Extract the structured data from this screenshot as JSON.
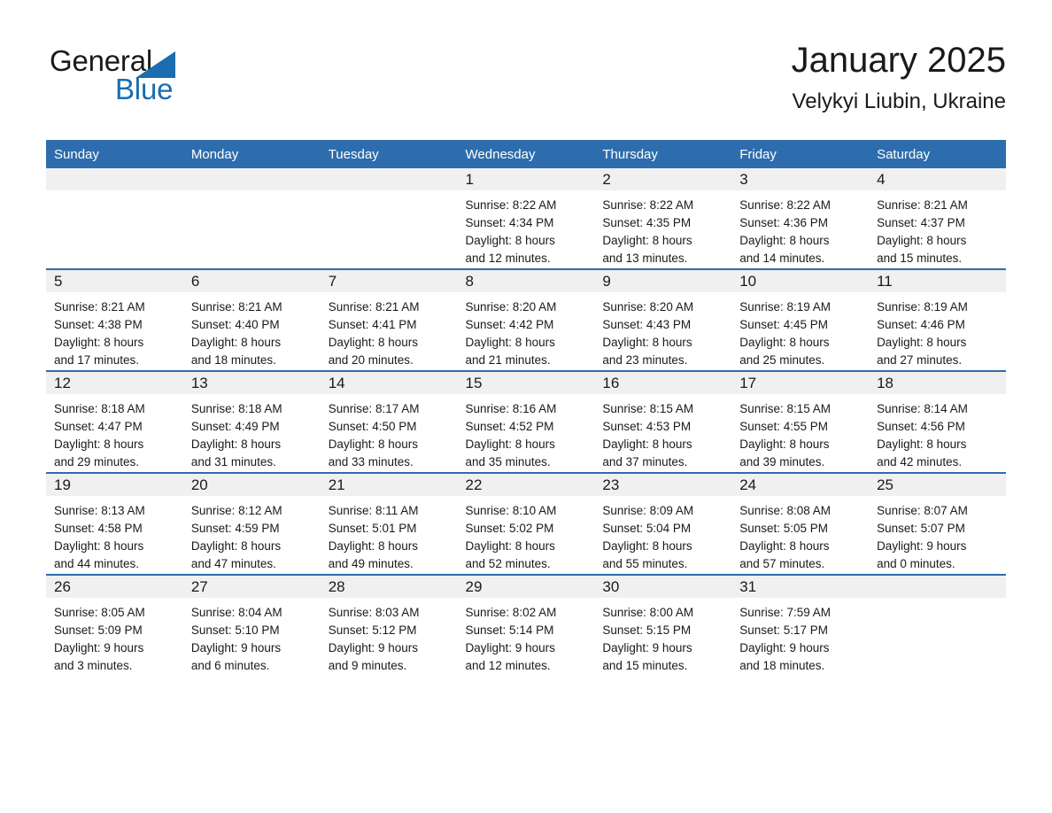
{
  "brand": {
    "name_part1": "General",
    "name_part2": "Blue",
    "triangle_color": "#1b6cb0"
  },
  "header": {
    "title": "January 2025",
    "subtitle": "Velykyi Liubin, Ukraine"
  },
  "theme": {
    "header_blue": "#2e6dad",
    "daynum_band": "#f0f0f0",
    "text": "#1a1a1a",
    "page_background": "#ffffff"
  },
  "weekday_headers": [
    "Sunday",
    "Monday",
    "Tuesday",
    "Wednesday",
    "Thursday",
    "Friday",
    "Saturday"
  ],
  "weeks": [
    {
      "days": [
        {
          "date": "",
          "empty": true,
          "sunrise": "",
          "sunset": "",
          "daylight_line1": "",
          "daylight_line2": ""
        },
        {
          "date": "",
          "empty": true,
          "sunrise": "",
          "sunset": "",
          "daylight_line1": "",
          "daylight_line2": ""
        },
        {
          "date": "",
          "empty": true,
          "sunrise": "",
          "sunset": "",
          "daylight_line1": "",
          "daylight_line2": ""
        },
        {
          "date": "1",
          "empty": false,
          "sunrise": "Sunrise: 8:22 AM",
          "sunset": "Sunset: 4:34 PM",
          "daylight_line1": "Daylight: 8 hours",
          "daylight_line2": "and 12 minutes."
        },
        {
          "date": "2",
          "empty": false,
          "sunrise": "Sunrise: 8:22 AM",
          "sunset": "Sunset: 4:35 PM",
          "daylight_line1": "Daylight: 8 hours",
          "daylight_line2": "and 13 minutes."
        },
        {
          "date": "3",
          "empty": false,
          "sunrise": "Sunrise: 8:22 AM",
          "sunset": "Sunset: 4:36 PM",
          "daylight_line1": "Daylight: 8 hours",
          "daylight_line2": "and 14 minutes."
        },
        {
          "date": "4",
          "empty": false,
          "sunrise": "Sunrise: 8:21 AM",
          "sunset": "Sunset: 4:37 PM",
          "daylight_line1": "Daylight: 8 hours",
          "daylight_line2": "and 15 minutes."
        }
      ]
    },
    {
      "days": [
        {
          "date": "5",
          "empty": false,
          "sunrise": "Sunrise: 8:21 AM",
          "sunset": "Sunset: 4:38 PM",
          "daylight_line1": "Daylight: 8 hours",
          "daylight_line2": "and 17 minutes."
        },
        {
          "date": "6",
          "empty": false,
          "sunrise": "Sunrise: 8:21 AM",
          "sunset": "Sunset: 4:40 PM",
          "daylight_line1": "Daylight: 8 hours",
          "daylight_line2": "and 18 minutes."
        },
        {
          "date": "7",
          "empty": false,
          "sunrise": "Sunrise: 8:21 AM",
          "sunset": "Sunset: 4:41 PM",
          "daylight_line1": "Daylight: 8 hours",
          "daylight_line2": "and 20 minutes."
        },
        {
          "date": "8",
          "empty": false,
          "sunrise": "Sunrise: 8:20 AM",
          "sunset": "Sunset: 4:42 PM",
          "daylight_line1": "Daylight: 8 hours",
          "daylight_line2": "and 21 minutes."
        },
        {
          "date": "9",
          "empty": false,
          "sunrise": "Sunrise: 8:20 AM",
          "sunset": "Sunset: 4:43 PM",
          "daylight_line1": "Daylight: 8 hours",
          "daylight_line2": "and 23 minutes."
        },
        {
          "date": "10",
          "empty": false,
          "sunrise": "Sunrise: 8:19 AM",
          "sunset": "Sunset: 4:45 PM",
          "daylight_line1": "Daylight: 8 hours",
          "daylight_line2": "and 25 minutes."
        },
        {
          "date": "11",
          "empty": false,
          "sunrise": "Sunrise: 8:19 AM",
          "sunset": "Sunset: 4:46 PM",
          "daylight_line1": "Daylight: 8 hours",
          "daylight_line2": "and 27 minutes."
        }
      ]
    },
    {
      "days": [
        {
          "date": "12",
          "empty": false,
          "sunrise": "Sunrise: 8:18 AM",
          "sunset": "Sunset: 4:47 PM",
          "daylight_line1": "Daylight: 8 hours",
          "daylight_line2": "and 29 minutes."
        },
        {
          "date": "13",
          "empty": false,
          "sunrise": "Sunrise: 8:18 AM",
          "sunset": "Sunset: 4:49 PM",
          "daylight_line1": "Daylight: 8 hours",
          "daylight_line2": "and 31 minutes."
        },
        {
          "date": "14",
          "empty": false,
          "sunrise": "Sunrise: 8:17 AM",
          "sunset": "Sunset: 4:50 PM",
          "daylight_line1": "Daylight: 8 hours",
          "daylight_line2": "and 33 minutes."
        },
        {
          "date": "15",
          "empty": false,
          "sunrise": "Sunrise: 8:16 AM",
          "sunset": "Sunset: 4:52 PM",
          "daylight_line1": "Daylight: 8 hours",
          "daylight_line2": "and 35 minutes."
        },
        {
          "date": "16",
          "empty": false,
          "sunrise": "Sunrise: 8:15 AM",
          "sunset": "Sunset: 4:53 PM",
          "daylight_line1": "Daylight: 8 hours",
          "daylight_line2": "and 37 minutes."
        },
        {
          "date": "17",
          "empty": false,
          "sunrise": "Sunrise: 8:15 AM",
          "sunset": "Sunset: 4:55 PM",
          "daylight_line1": "Daylight: 8 hours",
          "daylight_line2": "and 39 minutes."
        },
        {
          "date": "18",
          "empty": false,
          "sunrise": "Sunrise: 8:14 AM",
          "sunset": "Sunset: 4:56 PM",
          "daylight_line1": "Daylight: 8 hours",
          "daylight_line2": "and 42 minutes."
        }
      ]
    },
    {
      "days": [
        {
          "date": "19",
          "empty": false,
          "sunrise": "Sunrise: 8:13 AM",
          "sunset": "Sunset: 4:58 PM",
          "daylight_line1": "Daylight: 8 hours",
          "daylight_line2": "and 44 minutes."
        },
        {
          "date": "20",
          "empty": false,
          "sunrise": "Sunrise: 8:12 AM",
          "sunset": "Sunset: 4:59 PM",
          "daylight_line1": "Daylight: 8 hours",
          "daylight_line2": "and 47 minutes."
        },
        {
          "date": "21",
          "empty": false,
          "sunrise": "Sunrise: 8:11 AM",
          "sunset": "Sunset: 5:01 PM",
          "daylight_line1": "Daylight: 8 hours",
          "daylight_line2": "and 49 minutes."
        },
        {
          "date": "22",
          "empty": false,
          "sunrise": "Sunrise: 8:10 AM",
          "sunset": "Sunset: 5:02 PM",
          "daylight_line1": "Daylight: 8 hours",
          "daylight_line2": "and 52 minutes."
        },
        {
          "date": "23",
          "empty": false,
          "sunrise": "Sunrise: 8:09 AM",
          "sunset": "Sunset: 5:04 PM",
          "daylight_line1": "Daylight: 8 hours",
          "daylight_line2": "and 55 minutes."
        },
        {
          "date": "24",
          "empty": false,
          "sunrise": "Sunrise: 8:08 AM",
          "sunset": "Sunset: 5:05 PM",
          "daylight_line1": "Daylight: 8 hours",
          "daylight_line2": "and 57 minutes."
        },
        {
          "date": "25",
          "empty": false,
          "sunrise": "Sunrise: 8:07 AM",
          "sunset": "Sunset: 5:07 PM",
          "daylight_line1": "Daylight: 9 hours",
          "daylight_line2": "and 0 minutes."
        }
      ]
    },
    {
      "days": [
        {
          "date": "26",
          "empty": false,
          "sunrise": "Sunrise: 8:05 AM",
          "sunset": "Sunset: 5:09 PM",
          "daylight_line1": "Daylight: 9 hours",
          "daylight_line2": "and 3 minutes."
        },
        {
          "date": "27",
          "empty": false,
          "sunrise": "Sunrise: 8:04 AM",
          "sunset": "Sunset: 5:10 PM",
          "daylight_line1": "Daylight: 9 hours",
          "daylight_line2": "and 6 minutes."
        },
        {
          "date": "28",
          "empty": false,
          "sunrise": "Sunrise: 8:03 AM",
          "sunset": "Sunset: 5:12 PM",
          "daylight_line1": "Daylight: 9 hours",
          "daylight_line2": "and 9 minutes."
        },
        {
          "date": "29",
          "empty": false,
          "sunrise": "Sunrise: 8:02 AM",
          "sunset": "Sunset: 5:14 PM",
          "daylight_line1": "Daylight: 9 hours",
          "daylight_line2": "and 12 minutes."
        },
        {
          "date": "30",
          "empty": false,
          "sunrise": "Sunrise: 8:00 AM",
          "sunset": "Sunset: 5:15 PM",
          "daylight_line1": "Daylight: 9 hours",
          "daylight_line2": "and 15 minutes."
        },
        {
          "date": "31",
          "empty": false,
          "sunrise": "Sunrise: 7:59 AM",
          "sunset": "Sunset: 5:17 PM",
          "daylight_line1": "Daylight: 9 hours",
          "daylight_line2": "and 18 minutes."
        },
        {
          "date": "",
          "empty": true,
          "sunrise": "",
          "sunset": "",
          "daylight_line1": "",
          "daylight_line2": ""
        }
      ]
    }
  ]
}
